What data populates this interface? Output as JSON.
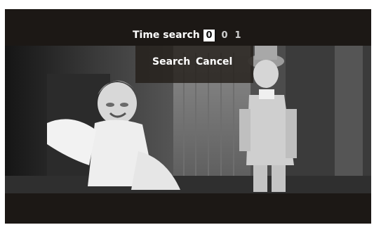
{
  "time_search": {
    "label": "Time search",
    "digits": [
      "0",
      "0",
      "1"
    ],
    "active_digit_index": 0
  },
  "menu": {
    "search_label": "Search",
    "cancel_label": "Cancel"
  },
  "colors": {
    "background": "#1c1815",
    "text": "#ffffff",
    "active_digit_bg": "#ffffff"
  }
}
